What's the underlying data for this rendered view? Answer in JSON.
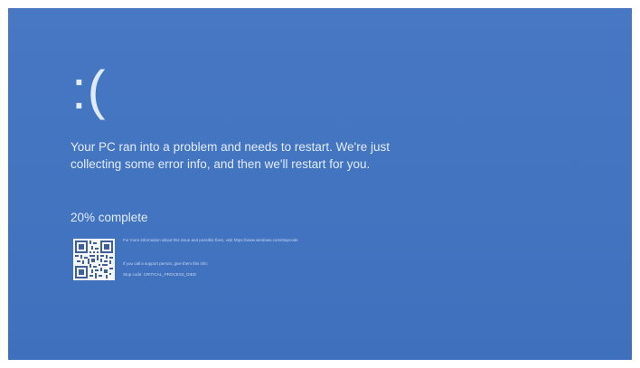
{
  "bsod": {
    "face": ":(",
    "message": "Your PC ran into a problem and needs to restart. We're just collecting some error info, and then we'll restart for you.",
    "progress_text": "20% complete",
    "progress_percent": 20,
    "details": {
      "info_line": "For more information about this issue and possible fixes, visit https://www.windows.com/stopcode",
      "support_line": "If you call a support person, give them this info:",
      "stop_code": "Stop code: CRITICAL_PROCESS_DIED"
    },
    "qr_icon": "qr-code-icon",
    "colors": {
      "background": "#4274c0",
      "text": "#e3ecfb",
      "qr": "#f4f7fd"
    }
  }
}
